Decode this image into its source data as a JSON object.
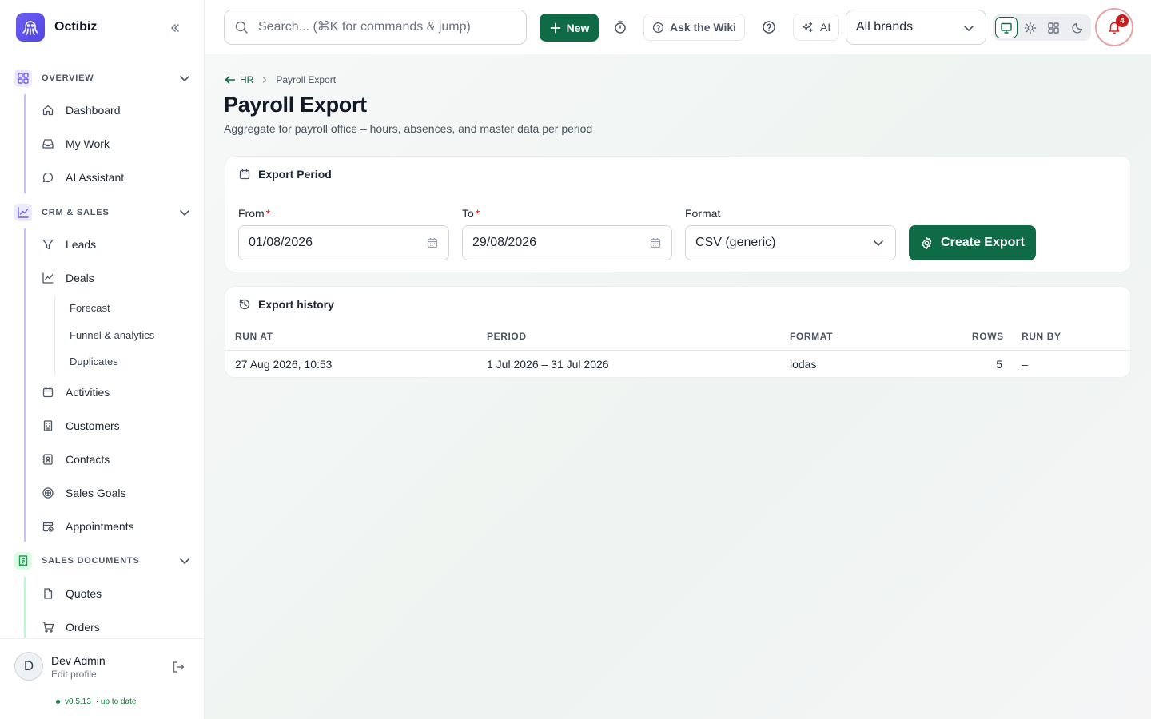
{
  "app": {
    "name": "Octibiz"
  },
  "sidebar": {
    "sections": [
      {
        "label": "OVERVIEW",
        "items": [
          "Dashboard",
          "My Work",
          "AI Assistant"
        ]
      },
      {
        "label": "CRM & SALES",
        "items": [
          "Leads",
          "Deals",
          "Activities",
          "Customers",
          "Contacts",
          "Sales Goals",
          "Appointments"
        ],
        "sub_items": [
          "Forecast",
          "Funnel & analytics",
          "Duplicates"
        ]
      },
      {
        "label": "SALES DOCUMENTS",
        "items": [
          "Quotes",
          "Orders"
        ]
      }
    ],
    "user": {
      "initial": "D",
      "name": "Dev Admin",
      "edit": "Edit profile"
    },
    "version": "v0.5.13",
    "version_status": "· up to date"
  },
  "topbar": {
    "search_placeholder": "Search... (⌘K for commands & jump)",
    "new_label": "New",
    "wiki_label": "Ask the Wiki",
    "ai_label": "AI",
    "brand_selected": "All brands",
    "notification_count": "4"
  },
  "breadcrumb": {
    "back": "HR",
    "current": "Payroll Export"
  },
  "page": {
    "title": "Payroll Export",
    "subtitle": "Aggregate for payroll office – hours, absences, and master data per period"
  },
  "export_period": {
    "title": "Export Period",
    "from_label": "From",
    "from_value": "01/08/2026",
    "to_label": "To",
    "to_value": "29/08/2026",
    "format_label": "Format",
    "format_value": "CSV (generic)",
    "required_mark": "*",
    "create_label": "Create Export"
  },
  "history": {
    "title": "Export history",
    "columns": [
      "RUN AT",
      "PERIOD",
      "FORMAT",
      "ROWS",
      "RUN BY"
    ],
    "rows": [
      {
        "run_at": "27 Aug 2026, 10:53",
        "period": "1 Jul 2026 – 31 Jul 2026",
        "format": "lodas",
        "rows": "5",
        "run_by": "–"
      }
    ]
  },
  "colors": {
    "accent": "#0f6b45",
    "danger": "#c81e1e",
    "brand": "#5b4fe9"
  }
}
